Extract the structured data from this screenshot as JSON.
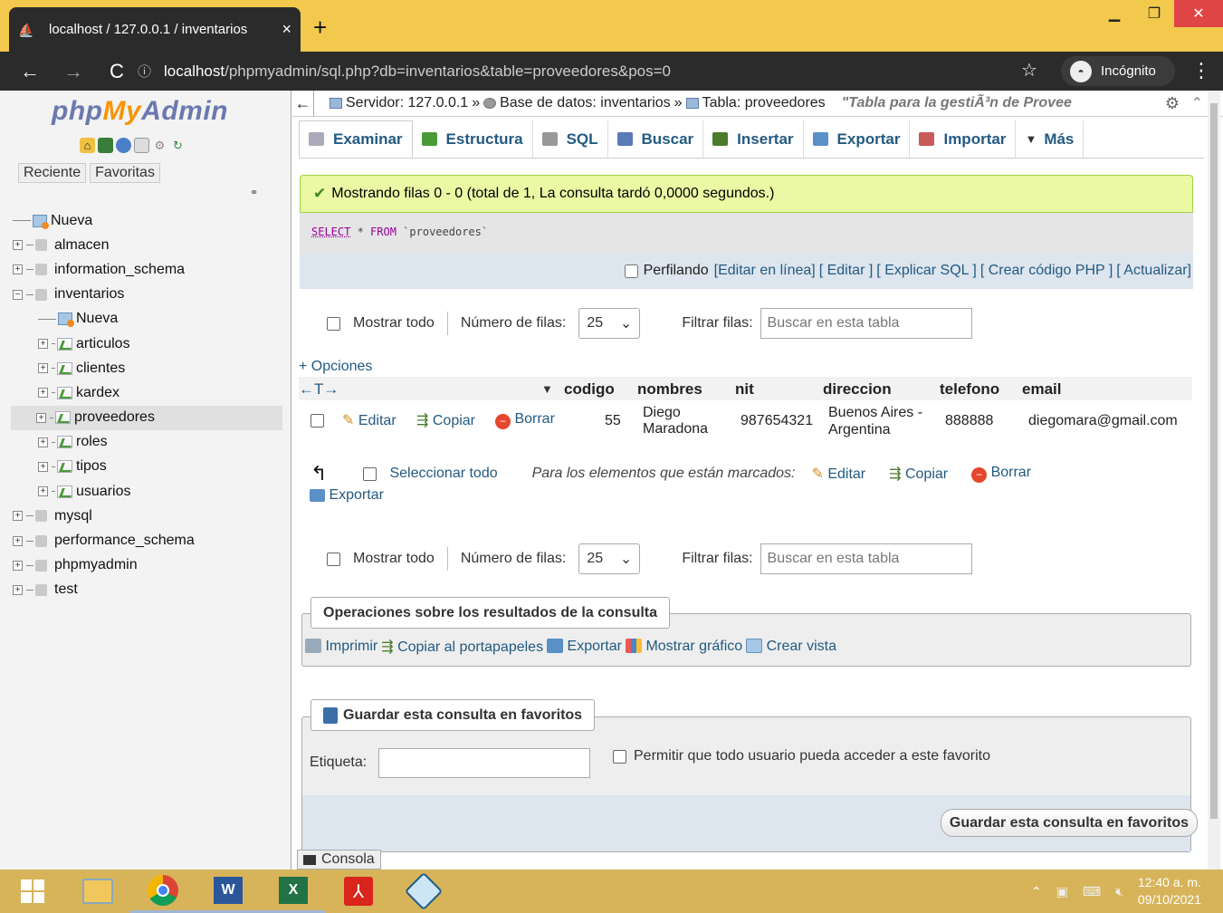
{
  "browser": {
    "tab_title": "localhost / 127.0.0.1 / inventarios",
    "tab_close": "×",
    "new_tab": "+",
    "url_host": "localhost",
    "url_rest": "/phpmyadmin/sql.php?db=inventarios&table=proveedores&pos=0",
    "incognito_label": "Incógnito"
  },
  "sidebar": {
    "logo_php": "php",
    "logo_my": "My",
    "logo_admin": "Admin",
    "tab_recent": "Reciente",
    "tab_favorites": "Favoritas",
    "tree": [
      {
        "label": "Nueva",
        "kind": "new",
        "level": 0
      },
      {
        "label": "almacen",
        "kind": "db",
        "level": 0
      },
      {
        "label": "information_schema",
        "kind": "db",
        "level": 0
      },
      {
        "label": "inventarios",
        "kind": "db-open",
        "level": 0
      },
      {
        "label": "Nueva",
        "kind": "new",
        "level": 1
      },
      {
        "label": "articulos",
        "kind": "table",
        "level": 1
      },
      {
        "label": "clientes",
        "kind": "table",
        "level": 1
      },
      {
        "label": "kardex",
        "kind": "table",
        "level": 1
      },
      {
        "label": "proveedores",
        "kind": "table",
        "level": 1,
        "selected": true
      },
      {
        "label": "roles",
        "kind": "table",
        "level": 1
      },
      {
        "label": "tipos",
        "kind": "table",
        "level": 1
      },
      {
        "label": "usuarios",
        "kind": "table",
        "level": 1
      },
      {
        "label": "mysql",
        "kind": "db",
        "level": 0
      },
      {
        "label": "performance_schema",
        "kind": "db",
        "level": 0
      },
      {
        "label": "phpmyadmin",
        "kind": "db",
        "level": 0
      },
      {
        "label": "test",
        "kind": "db",
        "level": 0
      }
    ]
  },
  "breadcrumb": {
    "server": "Servidor: 127.0.0.1",
    "database": "Base de datos: inventarios",
    "table": "Tabla: proveedores",
    "comment": "\"Tabla para la gestiÃ³n de Provee"
  },
  "menu": [
    "Examinar",
    "Estructura",
    "SQL",
    "Buscar",
    "Insertar",
    "Exportar",
    "Importar",
    "Más"
  ],
  "result": {
    "message": "Mostrando filas 0 - 0 (total de 1, La consulta tardó 0,0000 segundos.)",
    "sql_select": "SELECT",
    "sql_star": " * ",
    "sql_from": "FROM",
    "sql_table": " `proveedores`",
    "profiling": "Perfilando",
    "links": [
      "[Editar en línea]",
      "[ Editar ]",
      "[ Explicar SQL ]",
      "[ Crear código PHP ]",
      "[ Actualizar]"
    ]
  },
  "nav": {
    "show_all": "Mostrar todo",
    "rows_label": "Número de filas:",
    "rows_value": "25",
    "filter_label": "Filtrar filas:",
    "filter_placeholder": "Buscar en esta tabla"
  },
  "table": {
    "options": "+ Opciones",
    "arrows": "←T→",
    "columns": [
      "codigo",
      "nombres",
      "nit",
      "direccion",
      "telefono",
      "email"
    ],
    "row_actions": [
      "Editar",
      "Copiar",
      "Borrar"
    ],
    "row": {
      "codigo": "55",
      "nombres_1": "Diego",
      "nombres_2": "Maradona",
      "nit": "987654321",
      "direccion_1": "Buenos Aires -",
      "direccion_2": "Argentina",
      "telefono": "888888",
      "email": "diegomara@gmail.com"
    }
  },
  "bulk": {
    "select_all": "Seleccionar todo",
    "marked": "Para los elementos que están marcados:",
    "edit": "Editar",
    "copy": "Copiar",
    "delete": "Borrar",
    "export": "Exportar"
  },
  "operations": {
    "legend": "Operaciones sobre los resultados de la consulta",
    "print": "Imprimir",
    "copy_clipboard": "Copiar al portapapeles",
    "export": "Exportar",
    "chart": "Mostrar gráfico",
    "view": "Crear vista"
  },
  "bookmark": {
    "legend": "Guardar esta consulta en favoritos",
    "label": "Etiqueta:",
    "permit": "Permitir que todo usuario pueda acceder a este favorito",
    "save_button": "Guardar esta consulta en favoritos"
  },
  "console": "Consola",
  "taskbar": {
    "time": "12:40 a. m.",
    "date": "09/10/2021"
  },
  "colors": {
    "link": "#235a81",
    "success_bg": "#ebf8a4",
    "tab_strip": "#f2c94c",
    "taskbar": "#d7b45a"
  }
}
